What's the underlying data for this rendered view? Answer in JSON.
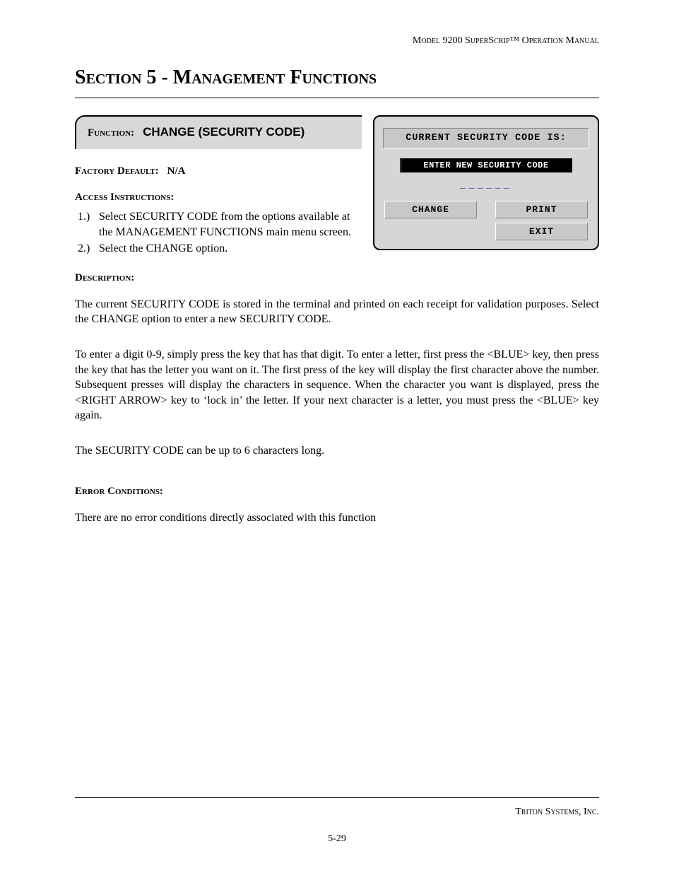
{
  "header": {
    "running_head": "Model 9200 SuperScrip™ Operation Manual"
  },
  "section_title": "Section 5 - Management Functions",
  "function_panel": {
    "label": "Function:",
    "value": "CHANGE (SECURITY CODE)"
  },
  "factory_default": {
    "label": "Factory Default:",
    "value": "N/A"
  },
  "access": {
    "label": "Access Instructions:",
    "steps": [
      {
        "num": "1.)",
        "text": "Select SECURITY CODE from the options available at the MANAGEMENT FUNCTIONS main menu screen."
      },
      {
        "num": "2.)",
        "text": "Select the CHANGE option."
      }
    ]
  },
  "screen": {
    "title": "CURRENT SECURITY CODE IS:",
    "prompt": "ENTER NEW SECURITY CODE",
    "entry_placeholder": "______",
    "buttons": {
      "change": "CHANGE",
      "print": "PRINT",
      "exit": "EXIT"
    }
  },
  "description": {
    "label": "Description:",
    "p1": "The current SECURITY CODE  is stored in the terminal and printed on each receipt for validation purposes. Select the CHANGE option to enter a new SECURITY CODE.",
    "p2": "To enter a digit 0-9, simply press the key that has that digit.  To enter a letter, first press the <BLUE> key, then press the key that has the letter you want on it.  The first press of the key will display the first character above the number.  Subsequent presses will display the characters in sequence.  When the character you want is displayed, press the <RIGHT ARROW> key to ‘lock in’ the letter.  If your next character is a letter, you must press the <BLUE> key again.",
    "p3": "The SECURITY CODE can be up to 6 characters long."
  },
  "errors": {
    "label": "Error Conditions:",
    "text": "There are no error conditions directly associated with this function"
  },
  "footer": {
    "company": "Triton Systems, Inc.",
    "page_number": "5-29"
  }
}
